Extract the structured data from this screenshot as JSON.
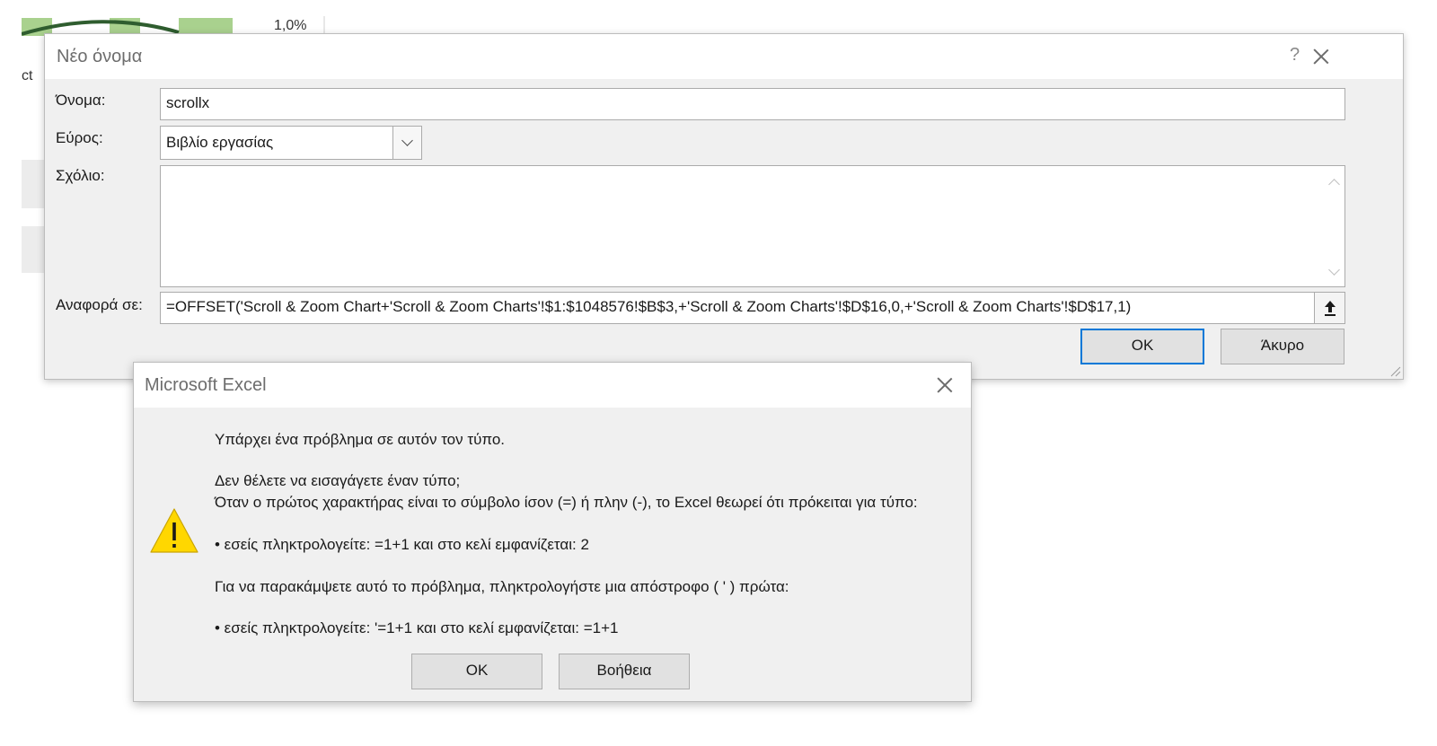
{
  "background": {
    "percent_label": "1,0%",
    "cut_text": "ct"
  },
  "new_name_dialog": {
    "title": "Νέο όνομα",
    "help_glyph": "?",
    "name_label": "Όνομα:",
    "name_value": "scrollx",
    "scope_label": "Εύρος:",
    "scope_value": "Βιβλίο εργασίας",
    "comment_label": "Σχόλιο:",
    "comment_value": "",
    "refers_to_label": "Αναφορά σε:",
    "refers_to_value": "=OFFSET('Scroll & Zoom Chart+'Scroll & Zoom Charts'!$1:$1048576!$B$3,+'Scroll & Zoom Charts'!$D$16,0,+'Scroll & Zoom Charts'!$D$17,1)",
    "ok_label": "OK",
    "cancel_label": "Άκυρο"
  },
  "excel_message": {
    "title": "Microsoft Excel",
    "lines": [
      "Υπάρχει ένα πρόβλημα σε αυτόν τον τύπο.",
      "Δεν θέλετε να εισαγάγετε έναν τύπο;",
      "Όταν ο πρώτος χαρακτήρας είναι το σύμβολο ίσον (=) ή πλην (-), το Excel θεωρεί ότι πρόκειται για τύπο:",
      "• εσείς πληκτρολογείτε:  =1+1 και στο κελί εμφανίζεται:  2",
      "Για να παρακάμψετε αυτό το πρόβλημα, πληκτρολογήστε μια απόστροφο ( ' ) πρώτα:",
      "• εσείς πληκτρολογείτε:  '=1+1 και στο κελί εμφανίζεται:  =1+1"
    ],
    "ok_label": "OK",
    "help_label": "Βοήθεια",
    "icon": "warning-icon"
  },
  "colors": {
    "accent": "#0078d7",
    "warning_yellow": "#ffd700",
    "chart_green": "#a9d18e"
  }
}
